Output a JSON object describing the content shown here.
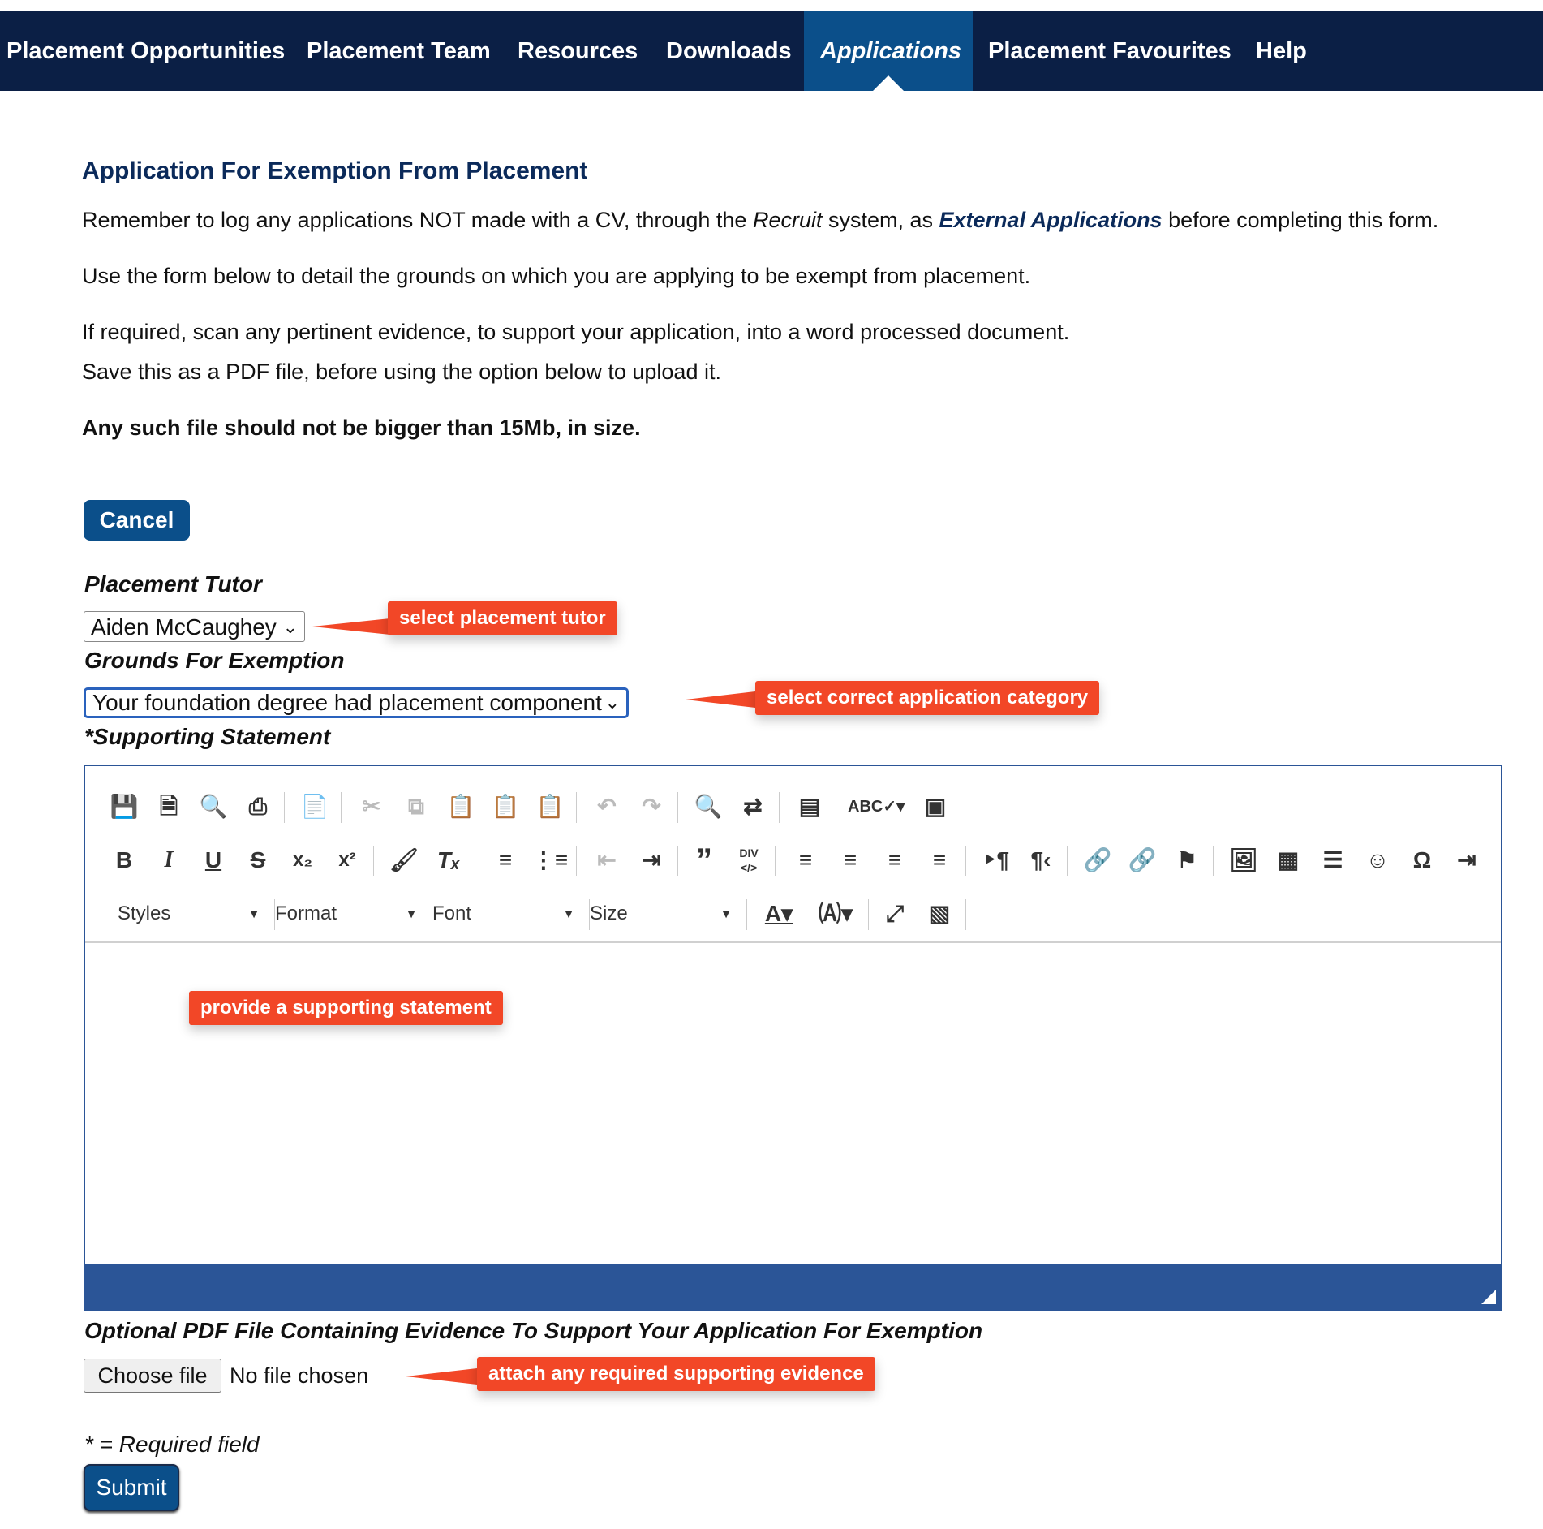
{
  "nav": {
    "items": [
      {
        "label": "Placement Opportunities"
      },
      {
        "label": "Placement Team"
      },
      {
        "label": "Resources"
      },
      {
        "label": "Downloads"
      },
      {
        "label": "Applications",
        "active": true
      },
      {
        "label": "Placement Favourites"
      },
      {
        "label": "Help"
      }
    ]
  },
  "page": {
    "title": "Application For Exemption From Placement",
    "p1": {
      "a": "Remember to log any applications NOT made with a CV, through the ",
      "b": "Recruit",
      "c": " system, as ",
      "d": "External Applications",
      "e": " before completing this form."
    },
    "p2": "Use the form below to detail the grounds on which you are applying to be exempt from placement.",
    "p3": "If required, scan any pertinent evidence, to support your application, into a word processed document.",
    "p4": "Save this as a PDF file, before using the option below to upload it.",
    "p5": "Any such file should not be bigger than 15Mb, in size."
  },
  "form": {
    "cancel_label": "Cancel",
    "tutor_label": "Placement Tutor",
    "tutor_value": "Aiden McCaughey",
    "grounds_label": "Grounds For Exemption",
    "grounds_value": "Your foundation degree had placement component",
    "statement_label": "*Supporting Statement",
    "evidence_label": "Optional PDF File Containing Evidence To Support Your Application For Exemption",
    "file_button": "Choose file",
    "file_status": "No file chosen",
    "required_note": "* = Required field",
    "submit_label": "Submit"
  },
  "editor": {
    "combos": {
      "styles": "Styles",
      "format": "Format",
      "font": "Font",
      "size": "Size"
    },
    "div_label": "DIV"
  },
  "callouts": {
    "tutor": "select placement tutor",
    "category": "select correct application category",
    "statement": "provide a supporting statement",
    "evidence": "attach any required supporting evidence"
  },
  "colors": {
    "nav_bg": "#0b1f45",
    "nav_active": "#0b4f8a",
    "accent": "#f24727",
    "editor_border": "#2b5597"
  }
}
